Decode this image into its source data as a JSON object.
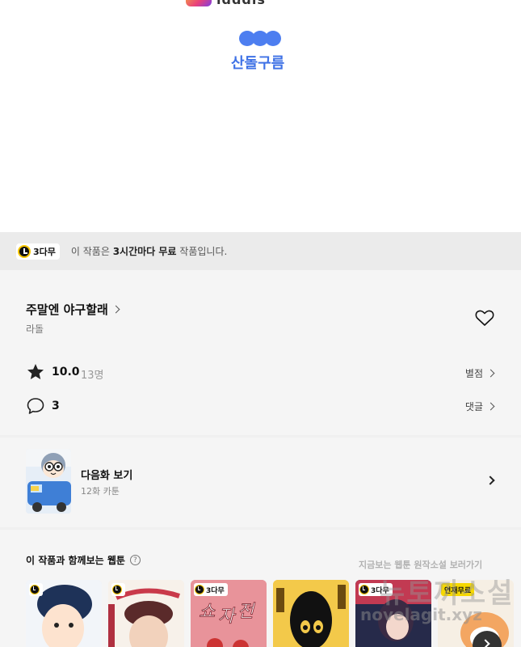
{
  "top": {
    "logo_text": "idddis",
    "studio_name": "산돌구름"
  },
  "free_banner": {
    "badge": "3다무",
    "text_prefix": "이 작품은 ",
    "text_bold1": "3시간마다 무료",
    "text_suffix": " 작품입니다."
  },
  "work": {
    "title": "주말엔 야구할래",
    "author": "라돌",
    "rating": "10.0",
    "rating_count": "13명",
    "rate_label": "별점",
    "comment_count": "3",
    "comment_label": "댓글"
  },
  "next_episode": {
    "title": "다음화 보기",
    "subtitle": "12화 카툰"
  },
  "recommend": {
    "title": "이 작품과 함께보는 웹툰",
    "help": "?",
    "cards": [
      {
        "badge": "",
        "name": "card-1"
      },
      {
        "badge": "",
        "name": "card-2"
      },
      {
        "badge": "3다무",
        "name": "card-3"
      },
      {
        "badge": "",
        "name": "card-4"
      },
      {
        "badge": "3다무",
        "name": "card-5"
      },
      {
        "badge": "연재무료",
        "name": "card-6"
      }
    ]
  },
  "watermark": {
    "line1": "지금보는 웹툰 원작소설 보러가기",
    "big": "뉴토끼소설",
    "url": "novelagit.xyz"
  },
  "colors": {
    "brand_blue": "#3f72e6",
    "badge_yellow": "#f7c600"
  }
}
